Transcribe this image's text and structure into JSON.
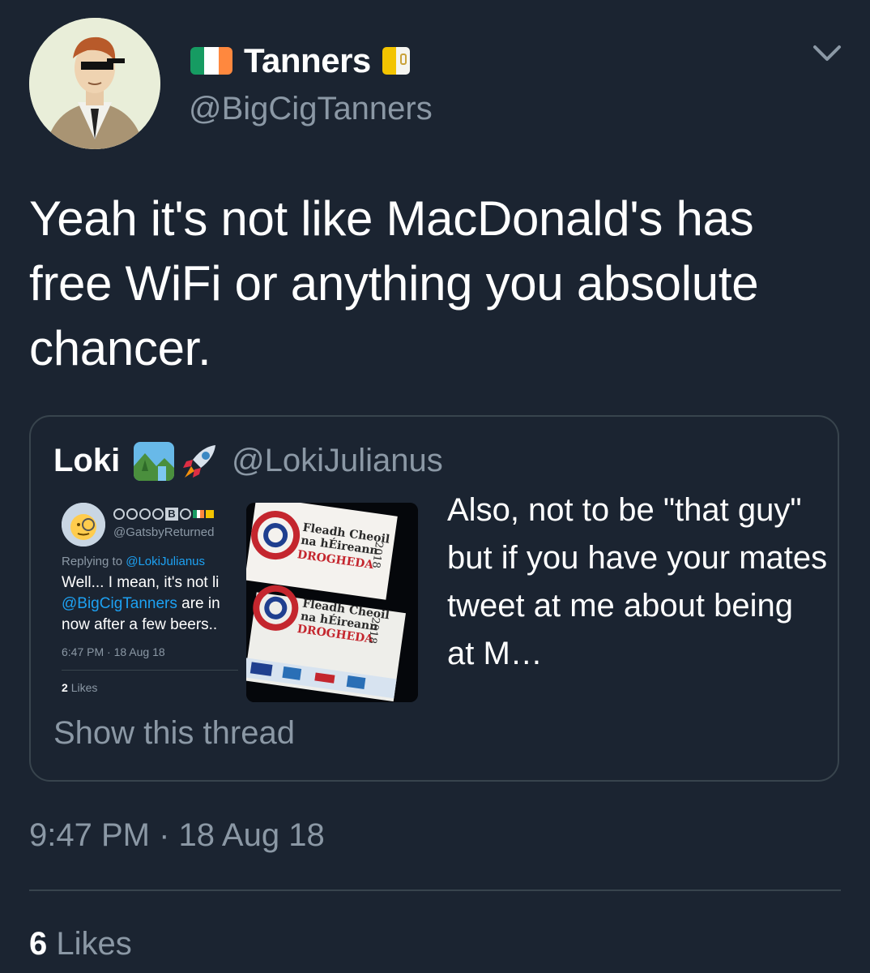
{
  "author": {
    "display_name": "Tanners",
    "handle": "@BigCigTanners",
    "avatar_icon": "cartoon-man-sunglasses-avatar",
    "flag_left_icon": "ireland-flag-icon",
    "flag_right_icon": "vatican-flag-icon"
  },
  "tweet": {
    "text": "Yeah it's not like MacDonald's has free WiFi or anything you absolute chancer.",
    "timestamp": "9:47 PM · 18 Aug 18",
    "likes_count": "6",
    "likes_label": "Likes"
  },
  "quoted_tweet": {
    "display_name": "Loki",
    "handle": "@LokiJulianus",
    "emoji_1": "national-park-emoji",
    "emoji_2": "rocket-emoji",
    "text": "Also, not to be \"that guy\" but if you have your mates tweet at me about being at M…",
    "show_thread": "Show this thread",
    "screenshot": {
      "name_badges": [
        "G",
        "A",
        "T",
        "S",
        "B",
        "Y"
      ],
      "handle": "@GatsbyReturned",
      "replying_prefix": "Replying to ",
      "replying_to": "@LokiJulianus",
      "body_line1": "Well... I mean, it's not li",
      "body_mention": "@BigCigTanners",
      "body_line2_rest": " are in",
      "body_line3": "now after a few beers..",
      "time": "6:47 PM · 18 Aug 18",
      "likes_count": "2",
      "likes_label": "Likes"
    },
    "photo": {
      "sign_line1": "Fleadh Cheoil",
      "sign_line2": "na hÉireann",
      "sign_line3": "DROGHEDA",
      "sign_year": "2018"
    }
  },
  "colors": {
    "background": "#1b2431",
    "secondary_text": "#8b98a5",
    "border": "#38444d",
    "link": "#1da1f2"
  }
}
